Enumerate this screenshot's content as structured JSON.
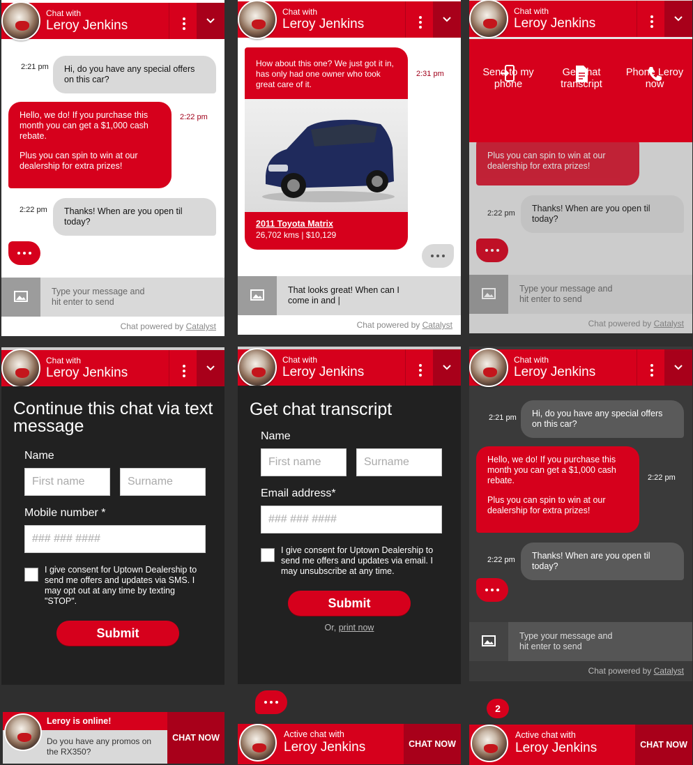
{
  "header": {
    "chat_with": "Chat with",
    "agent_name": "Leroy Jenkins"
  },
  "chat": {
    "m1": "Hi, do you have any special offers on this car?",
    "t1": "2:21 pm",
    "m2a": "Hello, we do! If you purchase this month you can get a $1,000 cash rebate.",
    "m2b": "Plus you can spin to win at our dealership for extra prizes!",
    "t2": "2:22 pm",
    "m3": "Thanks! When are you open til today?",
    "t3": "2:22 pm"
  },
  "car": {
    "msg": "How about this one? We just got it in, has only had one owner who took great care of it.",
    "time": "2:31 pm",
    "title": "2011 Toyota Matrix",
    "details": "26,702 kms | $10,129"
  },
  "input": {
    "placeholder": "Type your message and hit enter to send",
    "typed": "That looks great! When can I come in and |"
  },
  "powered": {
    "prefix": "Chat powered by ",
    "brand": "Catalyst"
  },
  "menu": {
    "send": "Send to my phone",
    "transcript": "Get chat transcript",
    "phone": "Phone Leroy now"
  },
  "sms_form": {
    "title": "Continue this chat via text message",
    "name_label": "Name",
    "first_ph": "First name",
    "surname_ph": "Surname",
    "mobile_label": "Mobile number *",
    "mobile_ph": "### ### ####",
    "consent": "I give consent for Uptown Dealership to send me offers and updates via SMS. I may opt out at any time by texting \"STOP\".",
    "submit": "Submit"
  },
  "transcript_form": {
    "title": "Get chat transcript",
    "name_label": "Name",
    "first_ph": "First name",
    "surname_ph": "Surname",
    "email_label": "Email address*",
    "email_ph": "### ### ####",
    "consent": "I give consent for Uptown Dealership to send me offers and updates via email. I may unsubscribe at any time.",
    "submit": "Submit",
    "or": "Or, ",
    "print": "print now"
  },
  "bars": {
    "online_title": "Leroy is online!",
    "online_msg": "Do you have any promos on the RX350?",
    "chat_now": "CHAT NOW",
    "active": "Active chat with",
    "name": "Leroy Jenkins",
    "badge": "2"
  },
  "colors": {
    "brand_red": "#d6001c",
    "dark_red": "#a8001a",
    "grey_bubble": "#d9d9d9",
    "dark_bg": "#3a3a3a"
  }
}
